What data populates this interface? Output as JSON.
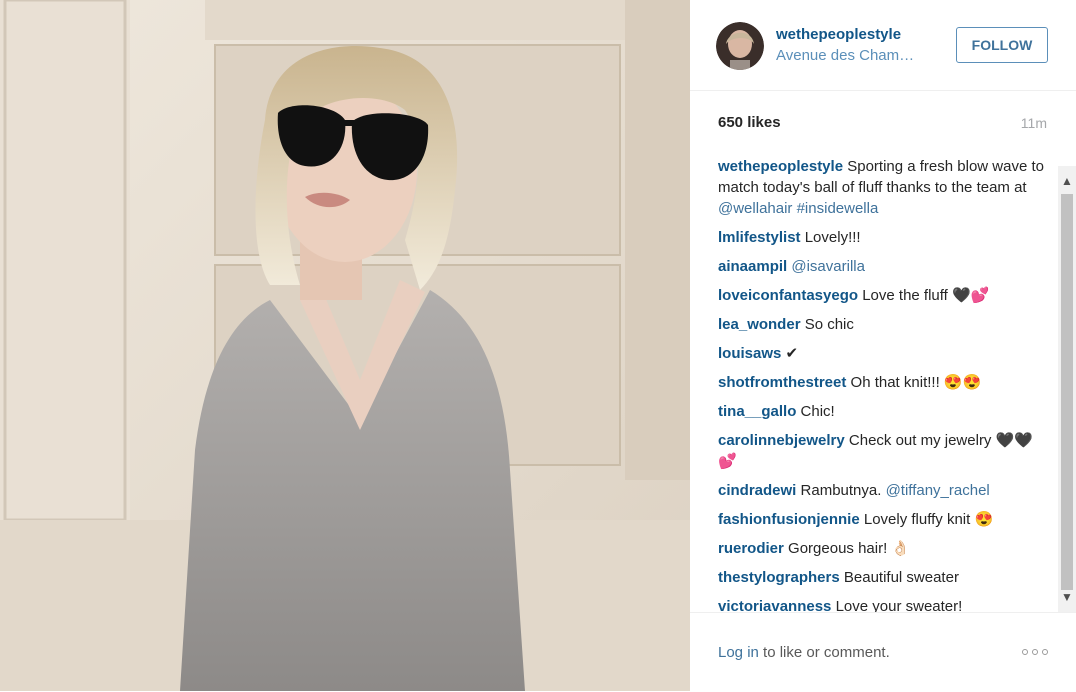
{
  "post": {
    "username": "wethepeoplestyle",
    "location": "Avenue des Cham…",
    "follow_label": "FOLLOW",
    "likes": "650 likes",
    "age": "11m"
  },
  "comments": [
    {
      "user": "wethepeoplestyle",
      "text": "Sporting a fresh blow wave to match today's ball of fluff thanks to the team at",
      "mentions": [
        "@wellahair",
        "#insidewella"
      ]
    },
    {
      "user": "lmlifestylist",
      "text": "Lovely!!!"
    },
    {
      "user": "ainaampil",
      "text": "",
      "mention": "@isavarilla"
    },
    {
      "user": "loveiconfantasyego",
      "text": "Love the fluff 🖤💕"
    },
    {
      "user": "lea_wonder",
      "text": "So chic"
    },
    {
      "user": "louisaws",
      "text": "✔"
    },
    {
      "user": "shotfromthestreet",
      "text": "Oh that knit!!! 😍😍"
    },
    {
      "user": "tina__gallo",
      "text": "Chic!"
    },
    {
      "user": "carolinnebjewelry",
      "text": "Check out my jewelry 🖤🖤💕"
    },
    {
      "user": "cindradewi",
      "text": "Rambutnya.",
      "mention": "@tiffany_rachel"
    },
    {
      "user": "fashionfusionjennie",
      "text": "Lovely fluffy knit 😍"
    },
    {
      "user": "ruerodier",
      "text": "Gorgeous hair! 👌🏻"
    },
    {
      "user": "thestylographers",
      "text": "Beautiful sweater"
    },
    {
      "user": "victoriavanness",
      "text": "Love your sweater!"
    }
  ],
  "footer": {
    "login_link": "Log in",
    "login_rest": " to like or comment."
  },
  "icons": {
    "more": "more-options-icon",
    "scroll_up": "scroll-up-arrow-icon",
    "scroll_down": "scroll-down-arrow-icon"
  }
}
